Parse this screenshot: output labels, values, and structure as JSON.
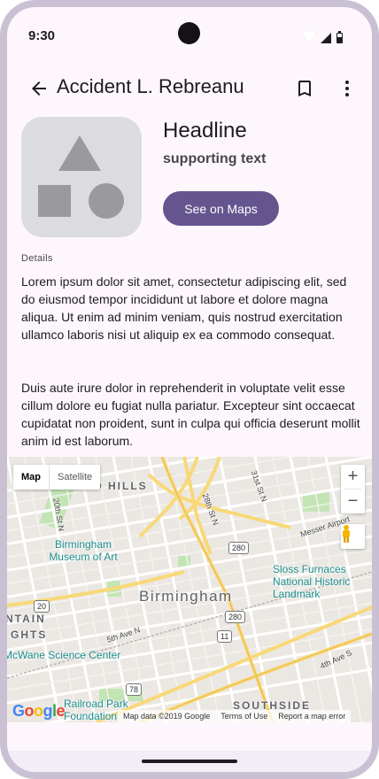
{
  "status_bar": {
    "time": "9:30"
  },
  "app_bar": {
    "title": "Accident L. Rebreanu"
  },
  "card": {
    "headline": "Headline",
    "supporting_text": "supporting text",
    "button_label": "See on Maps"
  },
  "details": {
    "label": "Details",
    "paragraph1": "Lorem ipsum dolor sit amet, consectetur adipiscing elit, sed do eiusmod tempor incididunt ut labore et dolore magna aliqua. Ut enim ad minim veniam, quis nostrud exercitation ullamco laboris nisi ut aliquip ex ea commodo consequat.",
    "paragraph2": "Duis aute irure dolor in reprehenderit in voluptate velit esse cillum dolore eu fugiat nulla pariatur. Excepteur sint occaecat cupidatat non proident, sunt in culpa qui officia deserunt mollit anim id est laborum."
  },
  "map": {
    "type_map": "Map",
    "type_satellite": "Satellite",
    "zoom_in": "+",
    "zoom_out": "−",
    "labels": {
      "city": "Birmingham",
      "museum_art": "Birmingham Museum of Art",
      "sloss": "Sloss Furnaces National Historic Landmark",
      "science_center": "McWane Science Center",
      "railroad_park": "Railroad Park Foundation",
      "southside": "SOUTHSIDE",
      "hills": "UID HILLS",
      "ntain": "NTAIN",
      "ghts": "GHTS",
      "st_28": "28th St N",
      "st_31": "31st St N",
      "st_20_n": "20th St N",
      "messer": "Messer Airport",
      "ave_5": "5th Ave N",
      "ave_4": "4th Ave S"
    },
    "shields": [
      "280",
      "280",
      "11",
      "78",
      "20"
    ],
    "footer": {
      "google": "Google",
      "map_data": "Map data ©2019 Google",
      "terms": "Terms of Use",
      "report": "Report a map error"
    }
  },
  "colors": {
    "primary": "#65558f",
    "surface": "#fdf7fd",
    "frame": "#c9c1d3"
  }
}
